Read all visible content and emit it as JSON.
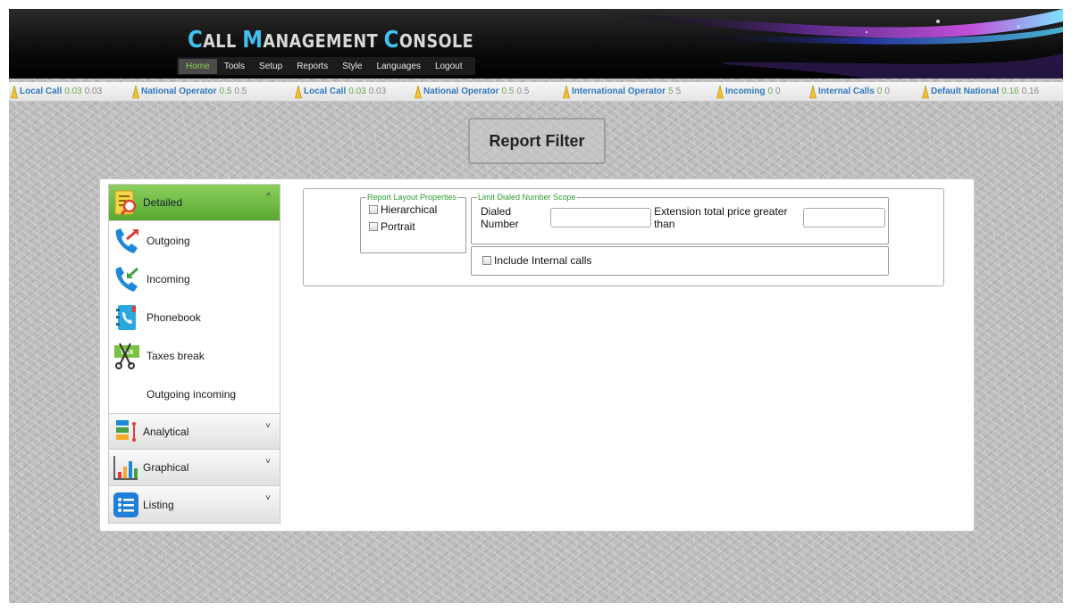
{
  "app": {
    "title_parts": [
      {
        "cap": "C",
        "rest": "ALL "
      },
      {
        "cap": "M",
        "rest": "ANAGEMENT "
      },
      {
        "cap": "C",
        "rest": "ONSOLE"
      }
    ]
  },
  "menu": [
    "Home",
    "Tools",
    "Setup",
    "Reports",
    "Style",
    "Languages",
    "Logout"
  ],
  "menu_active": "Home",
  "ticker": [
    {
      "name": "Local Call",
      "v1": "0.03",
      "v2": "0.03"
    },
    {
      "name": "National Operator",
      "v1": "0.5",
      "v2": "0.5"
    },
    {
      "name": "Local Call",
      "v1": "0.03",
      "v2": "0.03"
    },
    {
      "name": "National Operator",
      "v1": "0.5",
      "v2": "0.5"
    },
    {
      "name": "International Operator",
      "v1": "5",
      "v2": "5"
    },
    {
      "name": "Incoming",
      "v1": "0",
      "v2": "0"
    },
    {
      "name": "Internal Calls",
      "v1": "0",
      "v2": "0"
    },
    {
      "name": "Default National",
      "v1": "0.16",
      "v2": "0.16"
    }
  ],
  "report_filter_label": "Report Filter",
  "sidebar": {
    "detailed": {
      "label": "Detailed",
      "chevron": "^",
      "items": [
        {
          "label": "Outgoing",
          "icon": "outgoing-call-icon"
        },
        {
          "label": "Incoming",
          "icon": "incoming-call-icon"
        },
        {
          "label": "Phonebook",
          "icon": "phonebook-icon"
        },
        {
          "label": "Taxes break",
          "icon": "tax-scissors-icon"
        },
        {
          "label": "Outgoing incoming",
          "icon": ""
        }
      ]
    },
    "sections": [
      {
        "label": "Analytical",
        "icon": "analytical-icon",
        "chevron": "˅"
      },
      {
        "label": "Graphical",
        "icon": "bar-chart-icon",
        "chevron": "˅"
      },
      {
        "label": "Listing",
        "icon": "list-icon",
        "chevron": "˅"
      }
    ]
  },
  "filter": {
    "layout_legend": "Report Layout Properties",
    "hierarchical_label": "Hierarchical",
    "portrait_label": "Portrait",
    "scope_legend": "Limit Dialed Number Scope",
    "dialed_number_label": "Dialed Number",
    "dialed_number_value": "",
    "extension_price_label": "Extension total price greater than",
    "extension_price_value": "",
    "include_internal_label": "Include Internal calls"
  },
  "colors": {
    "accent_green": "#58a82f",
    "title_blue": "#3fc2f0",
    "ticker_name": "#2e78c0",
    "legend_green": "#2e9a2e"
  }
}
